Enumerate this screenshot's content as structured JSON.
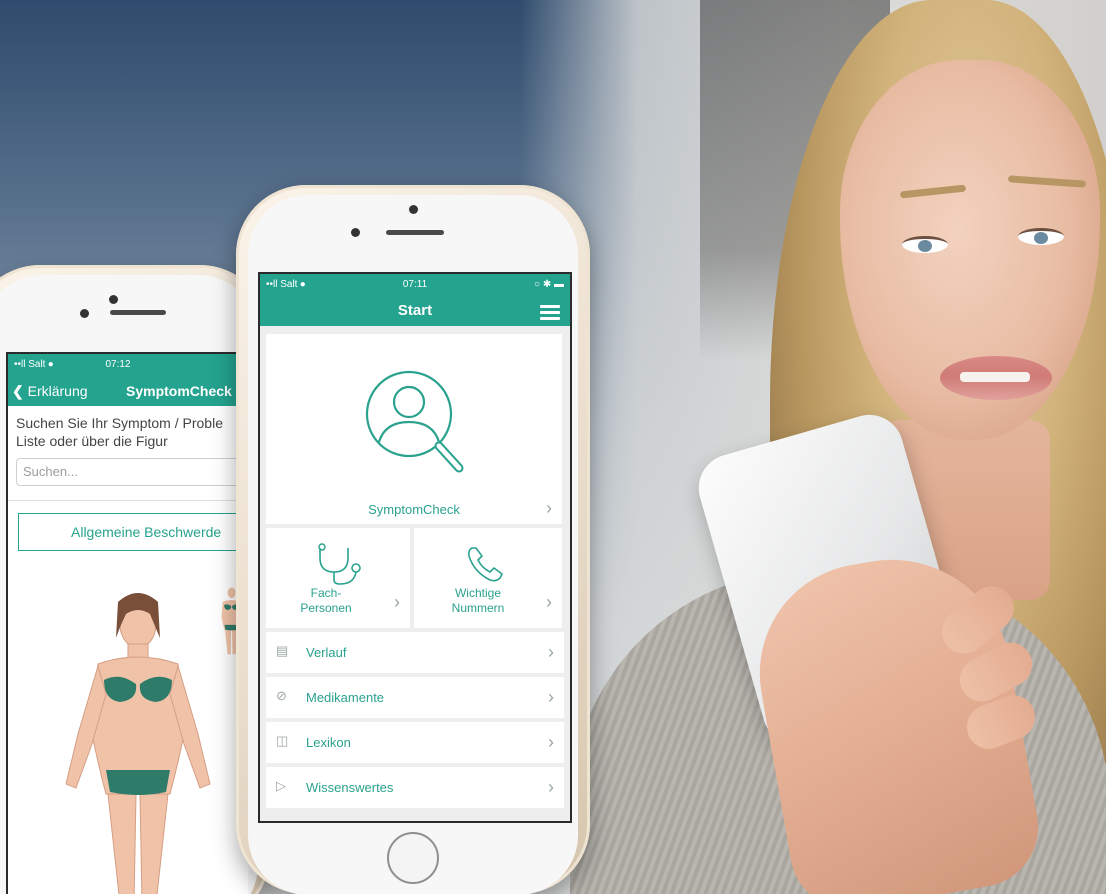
{
  "front_phone": {
    "status": {
      "carrier": "••ll Salt ⦁",
      "time": "07:11",
      "icons": "○ ✱ ▬"
    },
    "title": "Start",
    "menu_icon": "hamburger-icon",
    "symptom_card": {
      "label": "SymptomCheck",
      "icon": "magnifier-person-icon"
    },
    "tiles": [
      {
        "label": "Fach-\nPersonen",
        "icon": "stethoscope-icon"
      },
      {
        "label": "Wichtige\nNummern",
        "icon": "phone-icon"
      }
    ],
    "rows": [
      {
        "label": "Verlauf",
        "icon": "document-icon"
      },
      {
        "label": "Medikamente",
        "icon": "pill-icon"
      },
      {
        "label": "Lexikon",
        "icon": "book-icon"
      },
      {
        "label": "Wissenswertes",
        "icon": "megaphone-icon"
      }
    ],
    "chevron": "›",
    "accent_color": "#24a38f"
  },
  "back_phone": {
    "status": {
      "carrier": "••ll Salt ⦁",
      "time": "07:12"
    },
    "back_label": "Erklärung",
    "title": "SymptomCheck",
    "instruction": "Suchen Sie Ihr Symptom / Proble\nListe oder über die Figur",
    "search_placeholder": "Suchen...",
    "general_button": "Allgemeine Beschwerde"
  }
}
